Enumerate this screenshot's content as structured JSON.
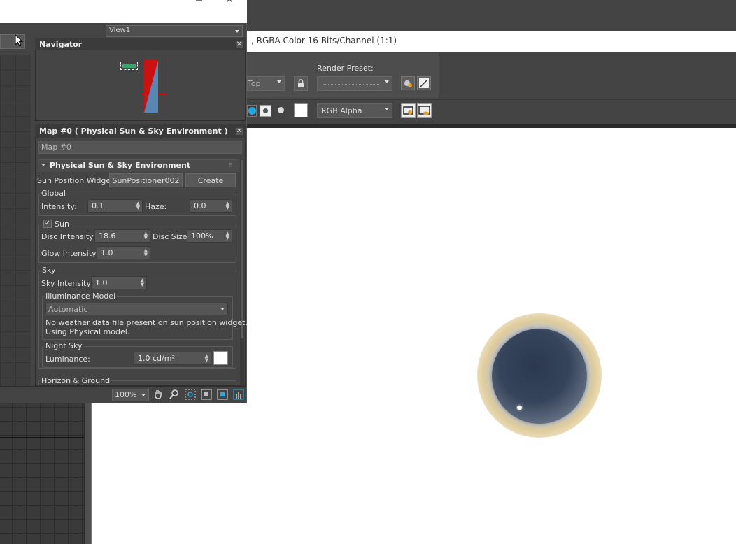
{
  "render_window": {
    "title": ", RGBA Color 16 Bits/Channel (1:1)",
    "viewport_select": "Top",
    "render_preset_label": "Render Preset:",
    "render_preset_value": "",
    "channel_select": "RGB Alpha"
  },
  "slate": {
    "view_select": "View1",
    "navigator_title": "Navigator",
    "material_title": "Map #0  ( Physical Sun & Sky Environment )",
    "map_name": "Map #0",
    "rollout_title": "Physical Sun & Sky Environment",
    "sun_widget_label": "Sun Position Widget:",
    "sun_widget_button": "SunPositioner002",
    "create_button": "Create",
    "global_group": "Global",
    "intensity_label": "Intensity:",
    "intensity_value": "0.1",
    "haze_label": "Haze:",
    "haze_value": "0.0",
    "sun_group": "Sun",
    "sun_checked": true,
    "disc_intensity_label": "Disc Intensity:",
    "disc_intensity_value": "18.6",
    "disc_size_label": "Disc Size:",
    "disc_size_value": "100%",
    "glow_intensity_label": "Glow Intensity:",
    "glow_intensity_value": "1.0",
    "sky_group": "Sky",
    "sky_intensity_label": "Sky Intensity:",
    "sky_intensity_value": "1.0",
    "illuminance_group": "Illuminance Model",
    "illuminance_value": "Automatic",
    "weather_note_1": "No weather data file present on sun position widget.",
    "weather_note_2": "Using Physical model.",
    "night_sky_group": "Night Sky",
    "luminance_label": "Luminance:",
    "luminance_value": "1.0 cd/m²",
    "horizon_group": "Horizon & Ground",
    "zoom_value": "100%"
  },
  "icons": [
    "hand-icon",
    "zoom-icon",
    "zoom-region-icon",
    "zoom-extents-icon",
    "zoom-selected-icon",
    "pan-to-selected-icon"
  ],
  "colors": {
    "accent_blue": "#23a7de",
    "nav_green": "#3ea36d",
    "nav_red": "#cc1111",
    "nav_blue": "#5a86b3"
  }
}
